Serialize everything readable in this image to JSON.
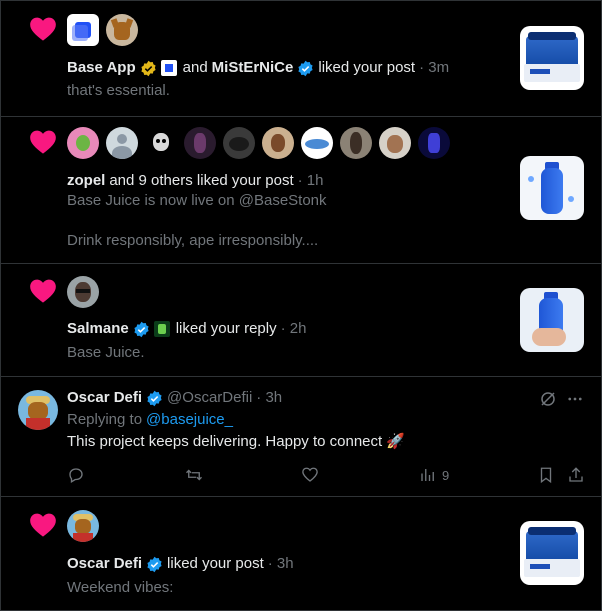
{
  "colors": {
    "heart": "#f91880",
    "verified": "#1d9bf0",
    "muted": "#71767b",
    "text": "#e7e9ea",
    "link": "#1d9bf0"
  },
  "n1": {
    "name1": "Base App",
    "and": "and",
    "name2": "MiStErNiCe",
    "action": "liked your post",
    "time": "· 3m",
    "snippet": "that's essential."
  },
  "n2": {
    "name": "zopel",
    "action": "and 9 others liked your post",
    "time": "· 1h",
    "snippet1": "Base Juice is now live on @BaseStonk",
    "snippet2": "Drink responsibly, ape irresponsibly...."
  },
  "n3": {
    "name": "Salmane",
    "action": "liked your reply",
    "time": "· 2h",
    "snippet": "Base Juice."
  },
  "reply": {
    "name": "Oscar Defi",
    "handle": "@OscarDefii",
    "time": "· 3h",
    "replying_prefix": "Replying to",
    "replying_to": "@basejuice_",
    "text": "This project keeps delivering. Happy to connect 🚀",
    "views": "9"
  },
  "n5": {
    "name": "Oscar Defi",
    "action": "liked your post",
    "time": "· 3h",
    "snippet": "Weekend vibes:"
  },
  "icons": [
    "heart-icon",
    "verified-badge-icon",
    "reply-icon",
    "retweet-icon",
    "like-icon",
    "views-icon",
    "bookmark-icon",
    "share-icon",
    "more-icon",
    "grok-icon"
  ]
}
